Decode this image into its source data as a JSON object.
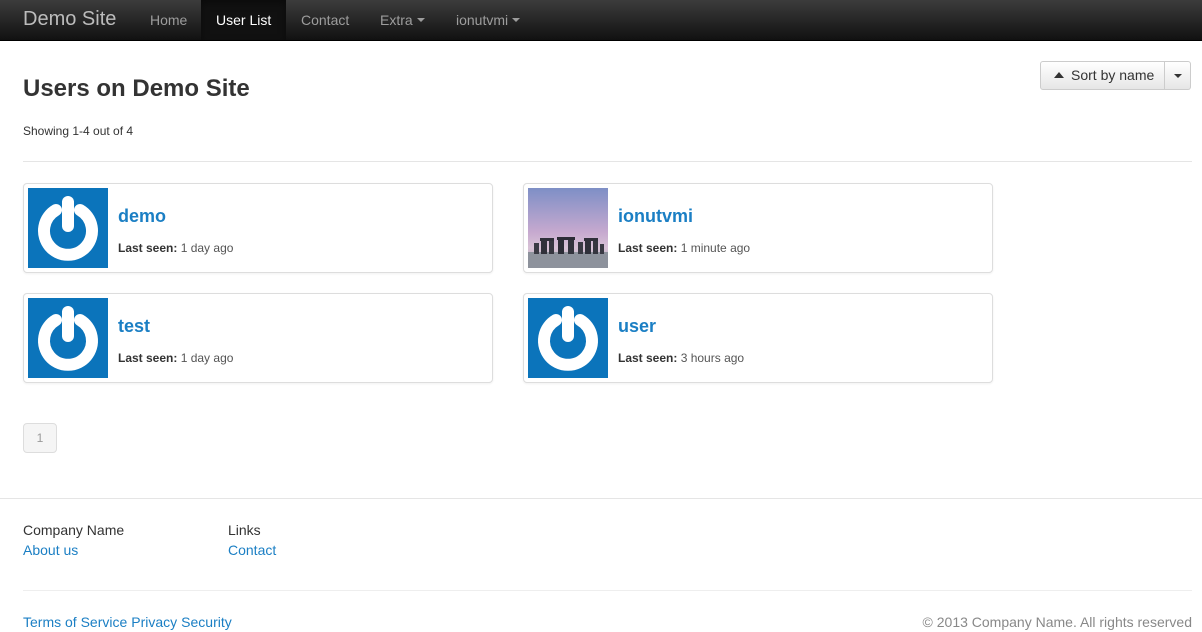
{
  "nav": {
    "brand": "Demo Site",
    "items": [
      {
        "label": "Home"
      },
      {
        "label": "User List"
      },
      {
        "label": "Contact"
      },
      {
        "label": "Extra"
      },
      {
        "label": "ionutvmi"
      }
    ]
  },
  "main": {
    "title": "Users on Demo Site",
    "showing": "Showing 1-4 out of 4",
    "sort_label": "Sort by name",
    "last_seen_label": "Last seen:",
    "users": [
      {
        "name": "demo",
        "last_seen": "1 day ago",
        "avatar": "power-icon"
      },
      {
        "name": "ionutvmi",
        "last_seen": "1 minute ago",
        "avatar": "stonehenge-photo"
      },
      {
        "name": "test",
        "last_seen": "1 day ago",
        "avatar": "power-icon"
      },
      {
        "name": "user",
        "last_seen": "3 hours ago",
        "avatar": "power-icon"
      }
    ],
    "pagination": {
      "current": "1"
    }
  },
  "footer": {
    "col1_title": "Company Name",
    "col1_link": "About us",
    "col2_title": "Links",
    "col2_link": "Contact",
    "bottom_links": [
      "Terms of Service",
      "Privacy",
      "Security"
    ],
    "copyright": "© 2013 Company Name. All rights reserved"
  },
  "colors": {
    "accent": "#1b7fc4",
    "avatar_bg": "#0b74bb",
    "navbar": "#222222"
  }
}
